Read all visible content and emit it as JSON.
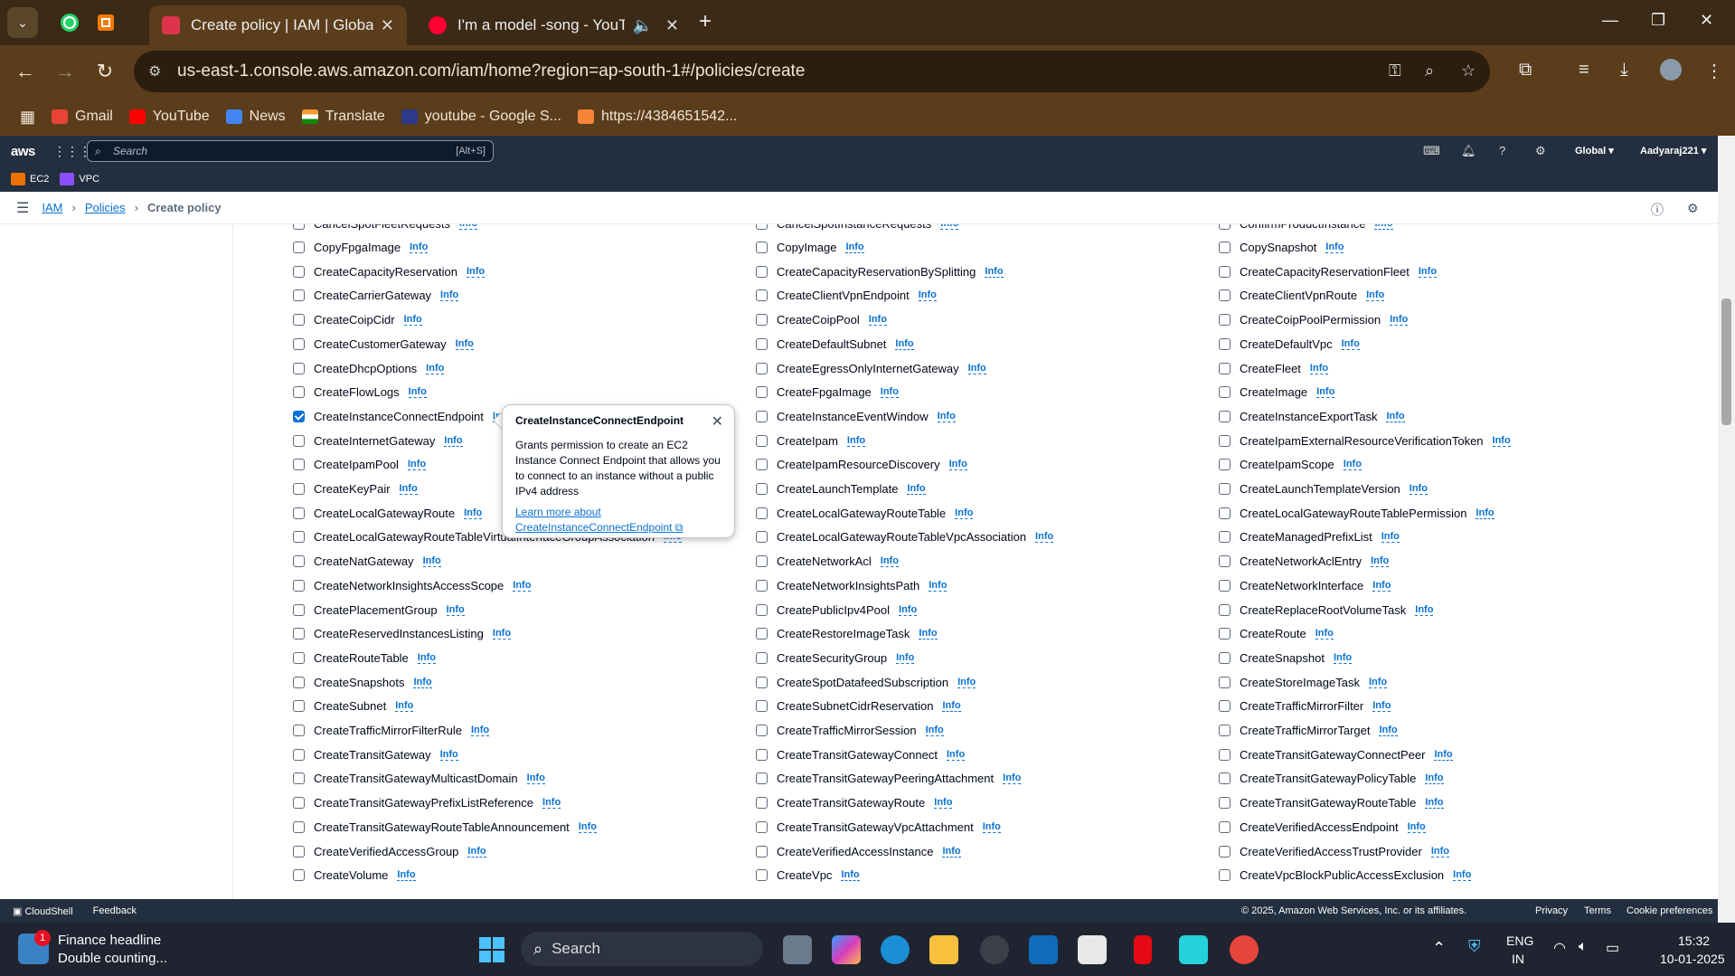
{
  "browser": {
    "tabs": [
      {
        "title": "Create policy | IAM | Global",
        "active": true
      },
      {
        "title": "I'm a model -song - YouTub",
        "active": false
      }
    ],
    "url": "us-east-1.console.aws.amazon.com/iam/home?region=ap-south-1#/policies/create",
    "bookmarks": [
      {
        "label": "Gmail",
        "icon": "gmail-icon",
        "color": "#ea4335"
      },
      {
        "label": "YouTube",
        "icon": "youtube-icon",
        "color": "#ff0000"
      },
      {
        "label": "News",
        "icon": "news-icon",
        "color": "#4285f4"
      },
      {
        "label": "Translate",
        "icon": "india-flag-icon",
        "color": "#ff9933"
      },
      {
        "label": "youtube - Google S...",
        "icon": "su-icon",
        "color": "#2b3a8a"
      },
      {
        "label": "https://4384651542...",
        "icon": "aws-cube-icon",
        "color": "#f58536"
      }
    ]
  },
  "aws": {
    "logo": "aws",
    "search_placeholder": "Search",
    "search_shortcut": "[Alt+S]",
    "region": "Global ▾",
    "account": "Aadyaraj221 ▾",
    "favorites": [
      {
        "label": "EC2",
        "color": "#ed7100"
      },
      {
        "label": "VPC",
        "color": "#8c4fff"
      }
    ]
  },
  "breadcrumb": {
    "items": [
      "IAM",
      "Policies"
    ],
    "current": "Create policy"
  },
  "actions": {
    "info_label": "Info",
    "top_partial": [
      "CancelSpotFleetRequests",
      "CancelSpotInstanceRequests",
      "ConfirmProductInstance"
    ],
    "col1": [
      "CopyFpgaImage",
      "CreateCapacityReservation",
      "CreateCarrierGateway",
      "CreateCoipCidr",
      "CreateCustomerGateway",
      "CreateDhcpOptions",
      "CreateFlowLogs",
      "CreateInstanceConnectEndpoint",
      "CreateInternetGateway",
      "CreateIpamPool",
      "CreateKeyPair",
      "CreateLocalGatewayRoute",
      "CreateLocalGatewayRouteTableVirtualInterfaceGroupAssociation",
      "CreateNatGateway",
      "CreateNetworkInsightsAccessScope",
      "CreatePlacementGroup",
      "CreateReservedInstancesListing",
      "CreateRouteTable",
      "CreateSnapshots",
      "CreateSubnet",
      "CreateTrafficMirrorFilterRule",
      "CreateTransitGateway",
      "CreateTransitGatewayMulticastDomain",
      "CreateTransitGatewayPrefixListReference",
      "CreateTransitGatewayRouteTableAnnouncement",
      "CreateVerifiedAccessGroup",
      "CreateVolume"
    ],
    "col2": [
      "CopyImage",
      "CreateCapacityReservationBySplitting",
      "CreateClientVpnEndpoint",
      "CreateCoipPool",
      "CreateDefaultSubnet",
      "CreateEgressOnlyInternetGateway",
      "CreateFpgaImage",
      "CreateInstanceEventWindow",
      "CreateIpam",
      "CreateIpamResourceDiscovery",
      "CreateLaunchTemplate",
      "CreateLocalGatewayRouteTable",
      "CreateLocalGatewayRouteTableVpcAssociation",
      "CreateNetworkAcl",
      "CreateNetworkInsightsPath",
      "CreatePublicIpv4Pool",
      "CreateRestoreImageTask",
      "CreateSecurityGroup",
      "CreateSpotDatafeedSubscription",
      "CreateSubnetCidrReservation",
      "CreateTrafficMirrorSession",
      "CreateTransitGatewayConnect",
      "CreateTransitGatewayPeeringAttachment",
      "CreateTransitGatewayRoute",
      "CreateTransitGatewayVpcAttachment",
      "CreateVerifiedAccessInstance",
      "CreateVpc"
    ],
    "col3": [
      "CopySnapshot",
      "CreateCapacityReservationFleet",
      "CreateClientVpnRoute",
      "CreateCoipPoolPermission",
      "CreateDefaultVpc",
      "CreateFleet",
      "CreateImage",
      "CreateInstanceExportTask",
      "CreateIpamExternalResourceVerificationToken",
      "CreateIpamScope",
      "CreateLaunchTemplateVersion",
      "CreateLocalGatewayRouteTablePermission",
      "CreateManagedPrefixList",
      "CreateNetworkAclEntry",
      "CreateNetworkInterface",
      "CreateReplaceRootVolumeTask",
      "CreateRoute",
      "CreateSnapshot",
      "CreateStoreImageTask",
      "CreateTrafficMirrorFilter",
      "CreateTrafficMirrorTarget",
      "CreateTransitGatewayConnectPeer",
      "CreateTransitGatewayPolicyTable",
      "CreateTransitGatewayRouteTable",
      "CreateVerifiedAccessEndpoint",
      "CreateVerifiedAccessTrustProvider",
      "CreateVpcBlockPublicAccessExclusion"
    ],
    "checked": [
      "CreateInstanceConnectEndpoint"
    ]
  },
  "popover": {
    "title": "CreateInstanceConnectEndpoint",
    "body": "Grants permission to create an EC2 Instance Connect Endpoint that allows you to connect to an instance without a public IPv4 address",
    "link_line1": "Learn more about",
    "link_line2": "CreateInstanceConnectEndpoint"
  },
  "footer": {
    "cloudshell": "CloudShell",
    "feedback": "Feedback",
    "copyright": "© 2025, Amazon Web Services, Inc. or its affiliates.",
    "privacy": "Privacy",
    "terms": "Terms",
    "cookies": "Cookie preferences"
  },
  "taskbar": {
    "news_badge": "1",
    "news_title": "Finance headline",
    "news_sub": "Double counting...",
    "search_label": "Search",
    "lang1": "ENG",
    "lang2": "IN",
    "time": "15:32",
    "date": "10-01-2025"
  }
}
